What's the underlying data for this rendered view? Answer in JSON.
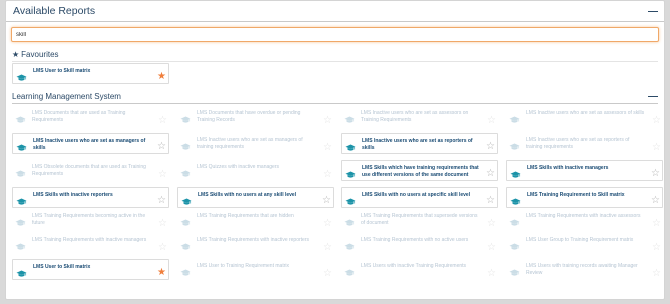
{
  "header": {
    "title": "Available Reports",
    "collapse_label": "—"
  },
  "search": {
    "value": "skill"
  },
  "favourites": {
    "title": "Favourites",
    "items": [
      {
        "label": "LMS User to Skill matrix",
        "state": "active",
        "starred": true
      }
    ]
  },
  "section": {
    "title": "Learning Management System",
    "collapse_label": "—",
    "items": [
      {
        "label": "LMS Documents that are used as Training Requirements",
        "state": "dim",
        "starred": false
      },
      {
        "label": "LMS Documents that have overdue or pending Training Records",
        "state": "dim",
        "starred": false
      },
      {
        "label": "LMS Inactive users who are set as assessors on Training Requirements",
        "state": "dim",
        "starred": false
      },
      {
        "label": "LMS Inactive users who are set as assessors of skills",
        "state": "dim",
        "starred": false
      },
      {
        "label": "LMS Inactive users who are set as managers of skills",
        "state": "active",
        "starred": false
      },
      {
        "label": "LMS Inactive users who are set as managers of training requirements",
        "state": "dim",
        "starred": false
      },
      {
        "label": "LMS Inactive users who are set as reporters of skills",
        "state": "active",
        "starred": false
      },
      {
        "label": "LMS Inactive users who are set as reporters of training requirements",
        "state": "dim",
        "starred": false
      },
      {
        "label": "LMS Obsolete documents that are used as Training Requirements",
        "state": "dim",
        "starred": false
      },
      {
        "label": "LMS Quizzes with inactive managers",
        "state": "dim",
        "starred": false
      },
      {
        "label": "LMS Skills which have training requirements that use different versions of the same document",
        "state": "active",
        "starred": false
      },
      {
        "label": "LMS Skills with inactive managers",
        "state": "active",
        "starred": false
      },
      {
        "label": "LMS Skills with inactive reporters",
        "state": "active",
        "starred": false
      },
      {
        "label": "LMS Skills with no users at any skill level",
        "state": "active",
        "starred": false
      },
      {
        "label": "LMS Skills with no users at specific skill level",
        "state": "active",
        "starred": false
      },
      {
        "label": "LMS Training Requirement to Skill matrix",
        "state": "active",
        "starred": false
      },
      {
        "label": "LMS Training Requirements becoming active in the future",
        "state": "dim",
        "starred": false
      },
      {
        "label": "LMS Training Requirements that are hidden",
        "state": "dim",
        "starred": false
      },
      {
        "label": "LMS Training Requirements that supersede versions of document",
        "state": "dim",
        "starred": false
      },
      {
        "label": "LMS Training Requirements with inactive assessors",
        "state": "dim",
        "starred": false
      },
      {
        "label": "LMS Training Requirements with inactive managers",
        "state": "dim",
        "starred": false
      },
      {
        "label": "LMS Training Requirements with inactive reporters",
        "state": "dim",
        "starred": false
      },
      {
        "label": "LMS Training Requirements with no active users",
        "state": "dim",
        "starred": false
      },
      {
        "label": "LMS User Group to Training Requirement matrix",
        "state": "dim",
        "starred": false
      },
      {
        "label": "LMS User to Skill matrix",
        "state": "active",
        "starred": true
      },
      {
        "label": "LMS User to Training Requirement matrix",
        "state": "dim",
        "starred": false
      },
      {
        "label": "LMS Users with inactive Training Requirements",
        "state": "dim",
        "starred": false
      },
      {
        "label": "LMS Users with training records awaiting Manager Review",
        "state": "dim",
        "starred": false
      }
    ]
  },
  "colors": {
    "accent": "#1b4c74",
    "star_active": "#f07f3c",
    "search_focus": "#f0a868",
    "icon_teal": "#1c93a8"
  },
  "icons": {
    "report": "graduation-cap-icon",
    "favourite": "star-icon",
    "section": "star-icon"
  }
}
